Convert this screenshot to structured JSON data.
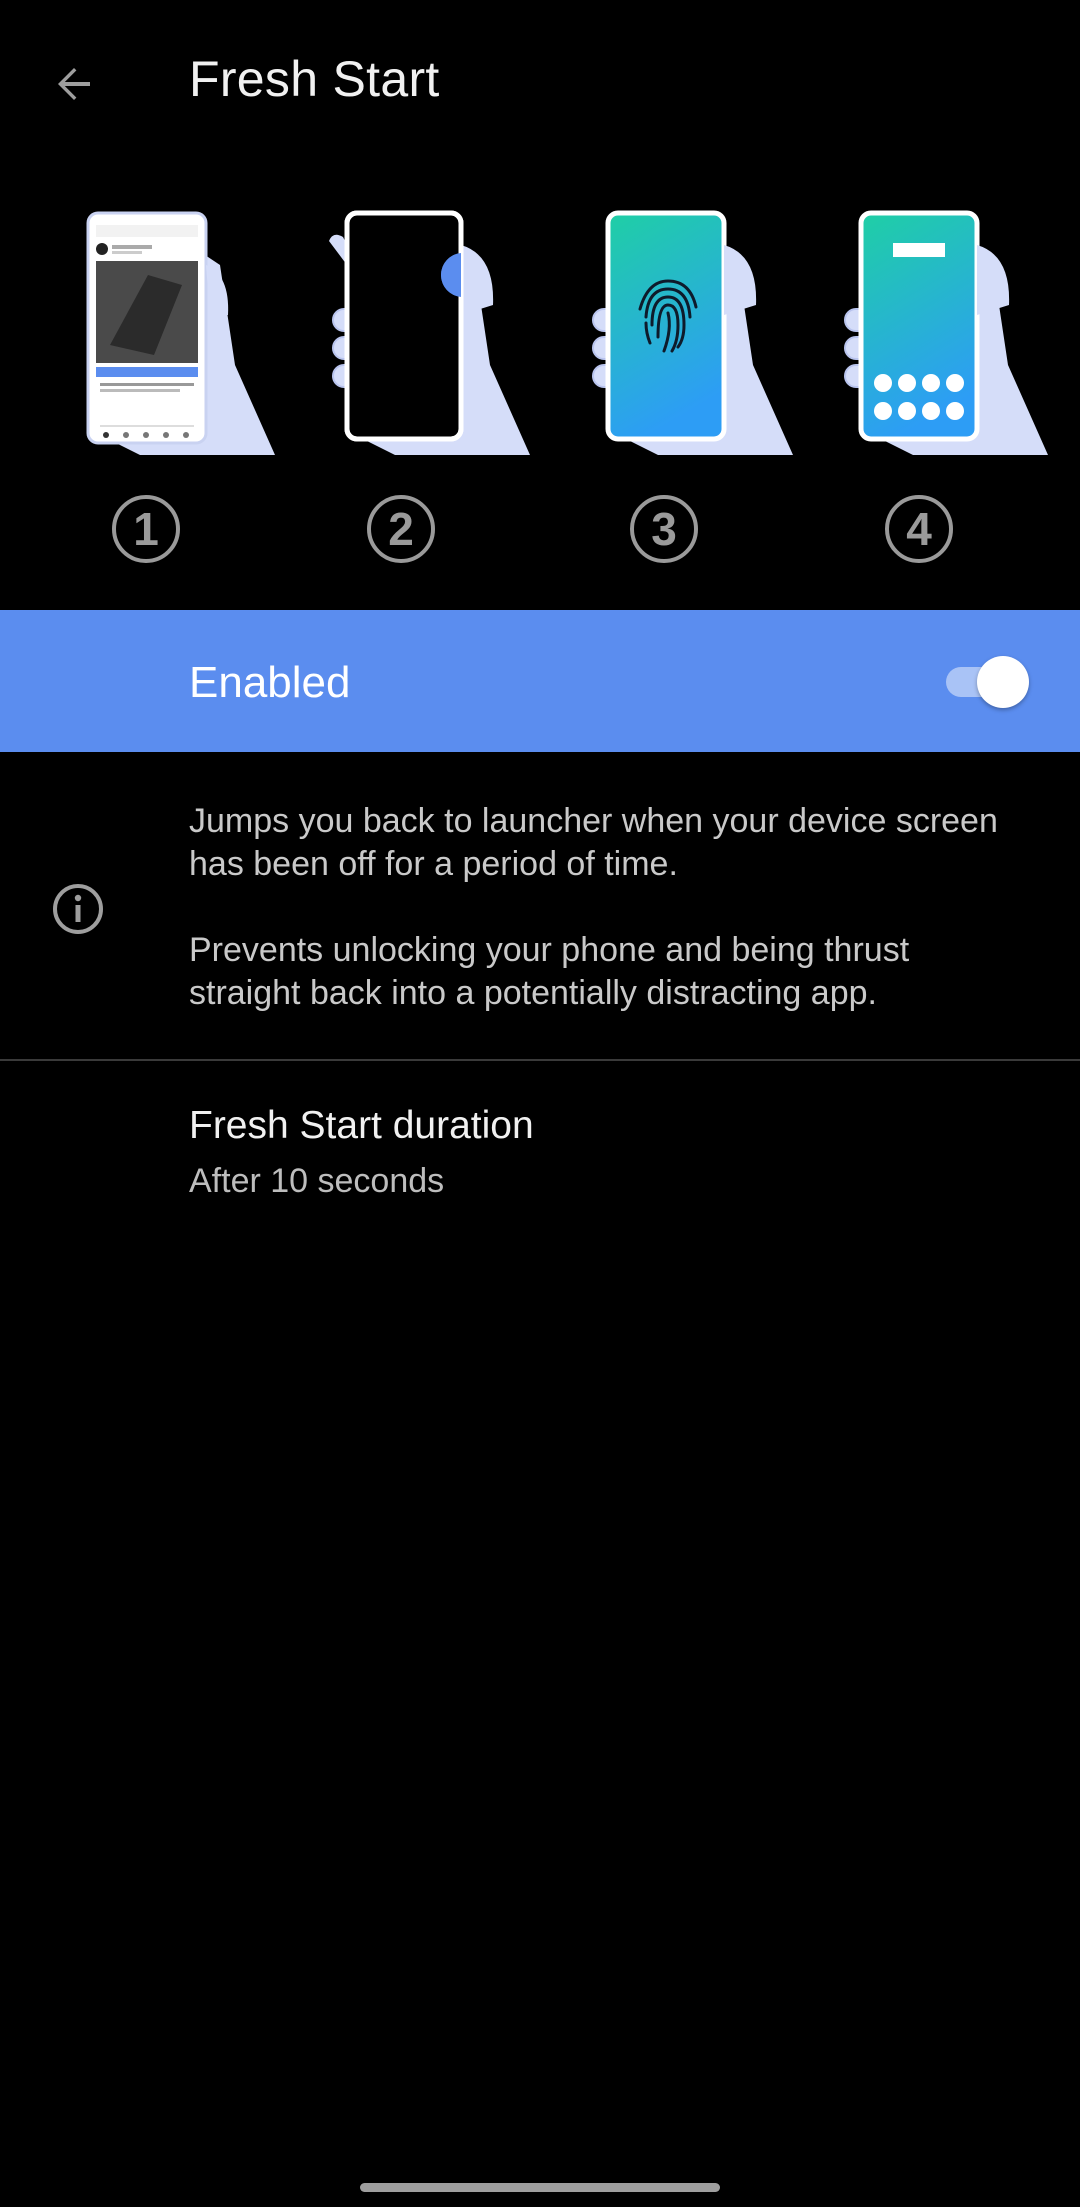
{
  "app_bar": {
    "title": "Fresh Start",
    "back_icon": "arrow-back-icon"
  },
  "steps": [
    {
      "number": "1",
      "illustration": "phone-feed-illustration"
    },
    {
      "number": "2",
      "illustration": "phone-screen-off-illustration"
    },
    {
      "number": "3",
      "illustration": "phone-fingerprint-illustration"
    },
    {
      "number": "4",
      "illustration": "phone-launcher-illustration"
    }
  ],
  "enabled_row": {
    "label": "Enabled",
    "toggle_on": true
  },
  "info": {
    "icon": "info-icon",
    "paragraph_1": "Jumps you back to launcher when your device screen has been off for a period of time.",
    "paragraph_2": "Prevents unlocking your phone and being thrust straight back into a potentially distracting app."
  },
  "duration": {
    "title": "Fresh Start duration",
    "summary": "After 10 seconds"
  },
  "colors": {
    "background": "#000000",
    "accent": "#5b8def",
    "hand": "#d5ddf9",
    "screen_gradient_start": "#1fcfa5",
    "screen_gradient_end": "#2d9df5"
  }
}
